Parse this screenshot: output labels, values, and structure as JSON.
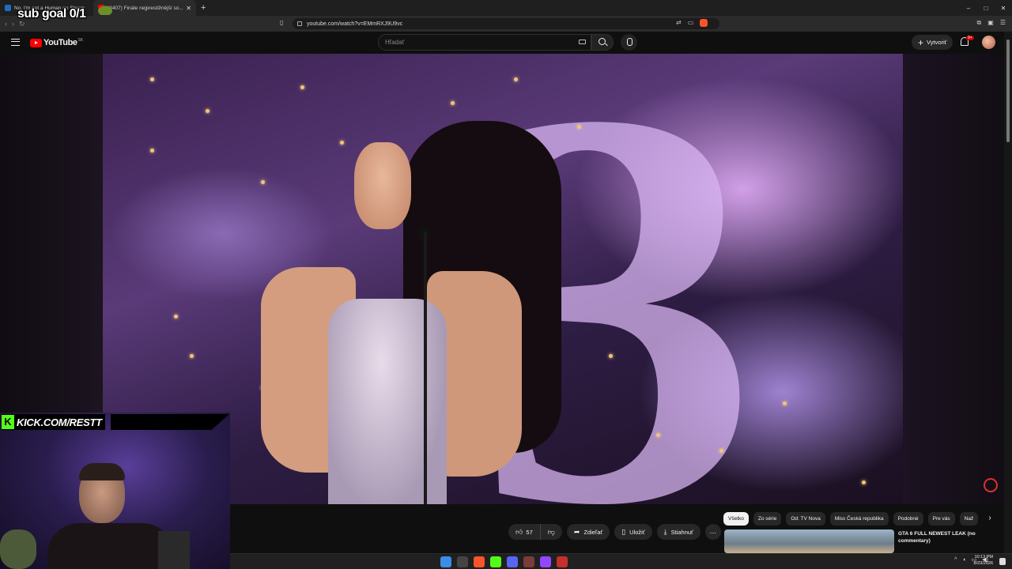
{
  "browser": {
    "tabs": [
      {
        "title": "No, I'm not a Human on Steam",
        "active": false
      },
      {
        "title": "(3407) Finále nejprestižnější so...",
        "active": true
      }
    ],
    "url": "youtube.com/watch?v=EMmRXJ9U9vc",
    "window_controls": [
      "–",
      "□",
      "✕"
    ]
  },
  "overlay": {
    "sub_goal": "sub goal 0/1",
    "kick_url": "KICK.COM/RESTT"
  },
  "youtube": {
    "logo_text": "YouTube",
    "region": "SK",
    "search_placeholder": "Hľadať",
    "create_label": "Vytvoriť",
    "notif_badge": "9+"
  },
  "actions": {
    "likes": "57",
    "share": "Zdieľať",
    "save": "Uložiť",
    "download": "Stiahnuť",
    "more": "…"
  },
  "chips": [
    "Všetko",
    "Zo série",
    "Od: TV Nova",
    "Miss Česká republika",
    "Podobné",
    "Pre vás",
    "Naž"
  ],
  "recommendation": {
    "title": "GTA 6 FULL NEWEST LEAK (no commentary)"
  },
  "taskbar": {
    "time": "10:13 PM",
    "date": "8/23/2026"
  },
  "colors": {
    "youtube_red": "#ff0000",
    "kick_green": "#53fc18",
    "background": "#0f0f0f"
  }
}
